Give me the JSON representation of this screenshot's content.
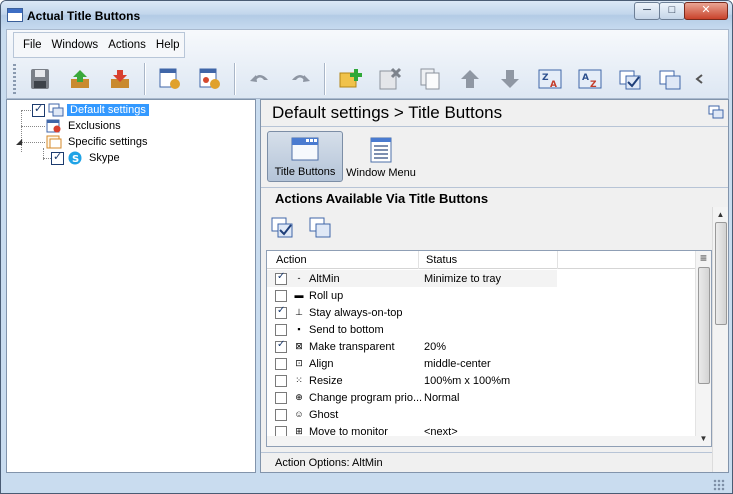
{
  "window": {
    "title": "Actual Title Buttons",
    "minimize": "─",
    "maximize": "□",
    "close": "✕"
  },
  "menu": [
    "File",
    "Windows",
    "Actions",
    "Help"
  ],
  "toolbar": [
    {
      "name": "save-icon"
    },
    {
      "name": "import-icon"
    },
    {
      "name": "export-icon"
    },
    {
      "name": "window-settings-icon"
    },
    {
      "name": "user-settings-icon"
    },
    {
      "name": "undo-icon"
    },
    {
      "name": "redo-icon"
    },
    {
      "name": "add-item-icon"
    },
    {
      "name": "delete-item-icon"
    },
    {
      "name": "copy-item-icon"
    },
    {
      "name": "move-up-icon"
    },
    {
      "name": "move-down-icon"
    },
    {
      "name": "sort-za-icon"
    },
    {
      "name": "sort-az-icon"
    },
    {
      "name": "check-all-icon"
    },
    {
      "name": "uncheck-all-icon"
    },
    {
      "name": "more-icon"
    }
  ],
  "tree": {
    "items": [
      {
        "label": "Default settings",
        "checked": true,
        "selected": true
      },
      {
        "label": "Exclusions"
      },
      {
        "label": "Specific settings"
      },
      {
        "label": "Skype",
        "checked": true
      }
    ]
  },
  "breadcrumb": "Default settings > Title Buttons",
  "modes": [
    {
      "label": "Title Buttons"
    },
    {
      "label": "Window Menu"
    }
  ],
  "section_title": "Actions Available Via Title Buttons",
  "table": {
    "columns": [
      "Action",
      "Status"
    ],
    "rows": [
      {
        "checked": true,
        "icon": "-",
        "action": "AltMin",
        "status": "Minimize to tray"
      },
      {
        "checked": false,
        "icon": "▬",
        "action": "Roll up",
        "status": ""
      },
      {
        "checked": true,
        "icon": "⊥",
        "action": "Stay always-on-top",
        "status": ""
      },
      {
        "checked": false,
        "icon": "▪",
        "action": "Send to bottom",
        "status": ""
      },
      {
        "checked": true,
        "icon": "⊠",
        "action": "Make transparent",
        "status": "20%"
      },
      {
        "checked": false,
        "icon": "⊡",
        "action": "Align",
        "status": "middle-center"
      },
      {
        "checked": false,
        "icon": "⁙",
        "action": "Resize",
        "status": "100%m x 100%m"
      },
      {
        "checked": false,
        "icon": "⊕",
        "action": "Change program prio...",
        "status": "Normal"
      },
      {
        "checked": false,
        "icon": "☺",
        "action": "Ghost",
        "status": ""
      },
      {
        "checked": false,
        "icon": "⊞",
        "action": "Move to monitor",
        "status": "<next>"
      },
      {
        "checked": false,
        "icon": "",
        "action": "",
        "status": ""
      }
    ]
  },
  "options_title": "Action Options: AltMin",
  "scroll_glyphs": {
    "up": "▲",
    "down": "▼",
    "menu": "≡"
  }
}
